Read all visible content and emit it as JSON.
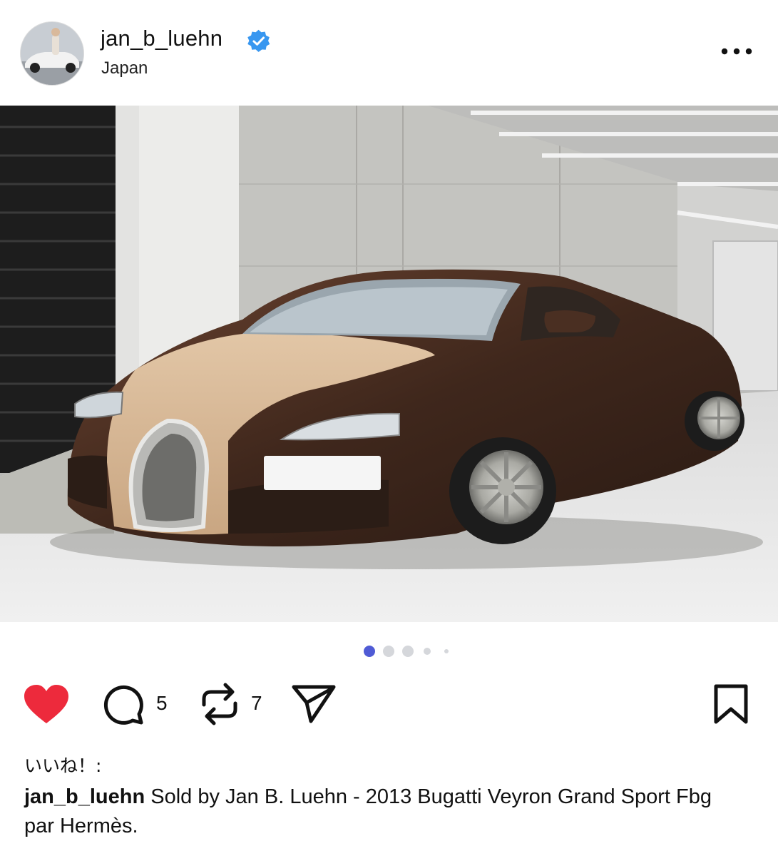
{
  "post": {
    "username": "jan_b_luehn",
    "location": "Japan",
    "verified": true,
    "more_icon": "more-horizontal-icon"
  },
  "media": {
    "description_icon": "car-photo",
    "carousel": {
      "total": 5,
      "active_index": 0
    }
  },
  "actions": {
    "like_icon": "heart-filled-icon",
    "like_color": "#ed2a3c",
    "comment_icon": "comment-bubble-icon",
    "comment_count": "5",
    "repost_icon": "repost-icon",
    "repost_count": "7",
    "share_icon": "send-icon",
    "save_icon": "bookmark-icon"
  },
  "likes_label": "いいね！:",
  "caption": {
    "username": "jan_b_luehn",
    "text": " Sold by Jan B. Luehn - 2013 Bugatti Veyron Grand Sport Fbg par Hermès."
  },
  "colors": {
    "verified_blue": "#3897f0",
    "active_dot": "#4f5bd5",
    "inactive_dot": "#d5d7db"
  }
}
